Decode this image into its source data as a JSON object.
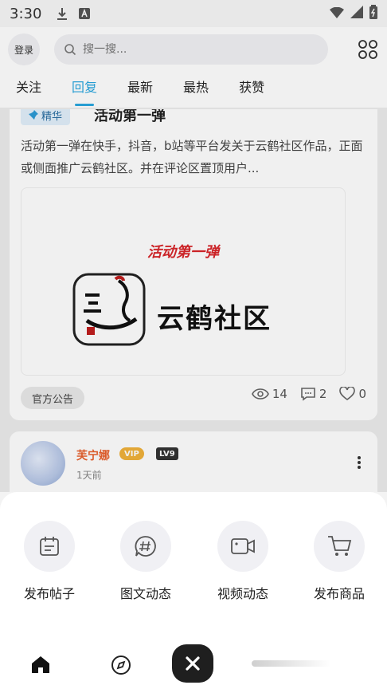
{
  "status_bar": {
    "time": "3:30"
  },
  "header": {
    "login_label": "登录",
    "search_placeholder": "搜一搜..."
  },
  "tabs": [
    {
      "label": "关注"
    },
    {
      "label": "回复"
    },
    {
      "label": "最新"
    },
    {
      "label": "最热"
    },
    {
      "label": "获赞"
    }
  ],
  "active_tab": "回复",
  "post": {
    "badge": "精华",
    "title": "活动第一弹",
    "body": "活动第一弹在快手，抖音，b站等平台发关于云鹤社区作品，正面或侧面推广云鹤社区。并在评论区置顶用户...",
    "image_caption": "活动第一弹",
    "logo_text": "云鹤社区",
    "tag": "官方公告",
    "views": "14",
    "comments": "2",
    "likes": "0"
  },
  "post2": {
    "username": "芙宁娜",
    "vip": "VIP",
    "level": "LV9",
    "time": "1天前"
  },
  "actions": [
    {
      "label": "发布帖子",
      "icon": "calendar-icon"
    },
    {
      "label": "图文动态",
      "icon": "hashtag-icon"
    },
    {
      "label": "视频动态",
      "icon": "video-icon"
    },
    {
      "label": "发布商品",
      "icon": "cart-icon"
    }
  ],
  "colors": {
    "accent": "#2aa7e0",
    "username": "#e8602c",
    "vip": "#f1b23b"
  }
}
